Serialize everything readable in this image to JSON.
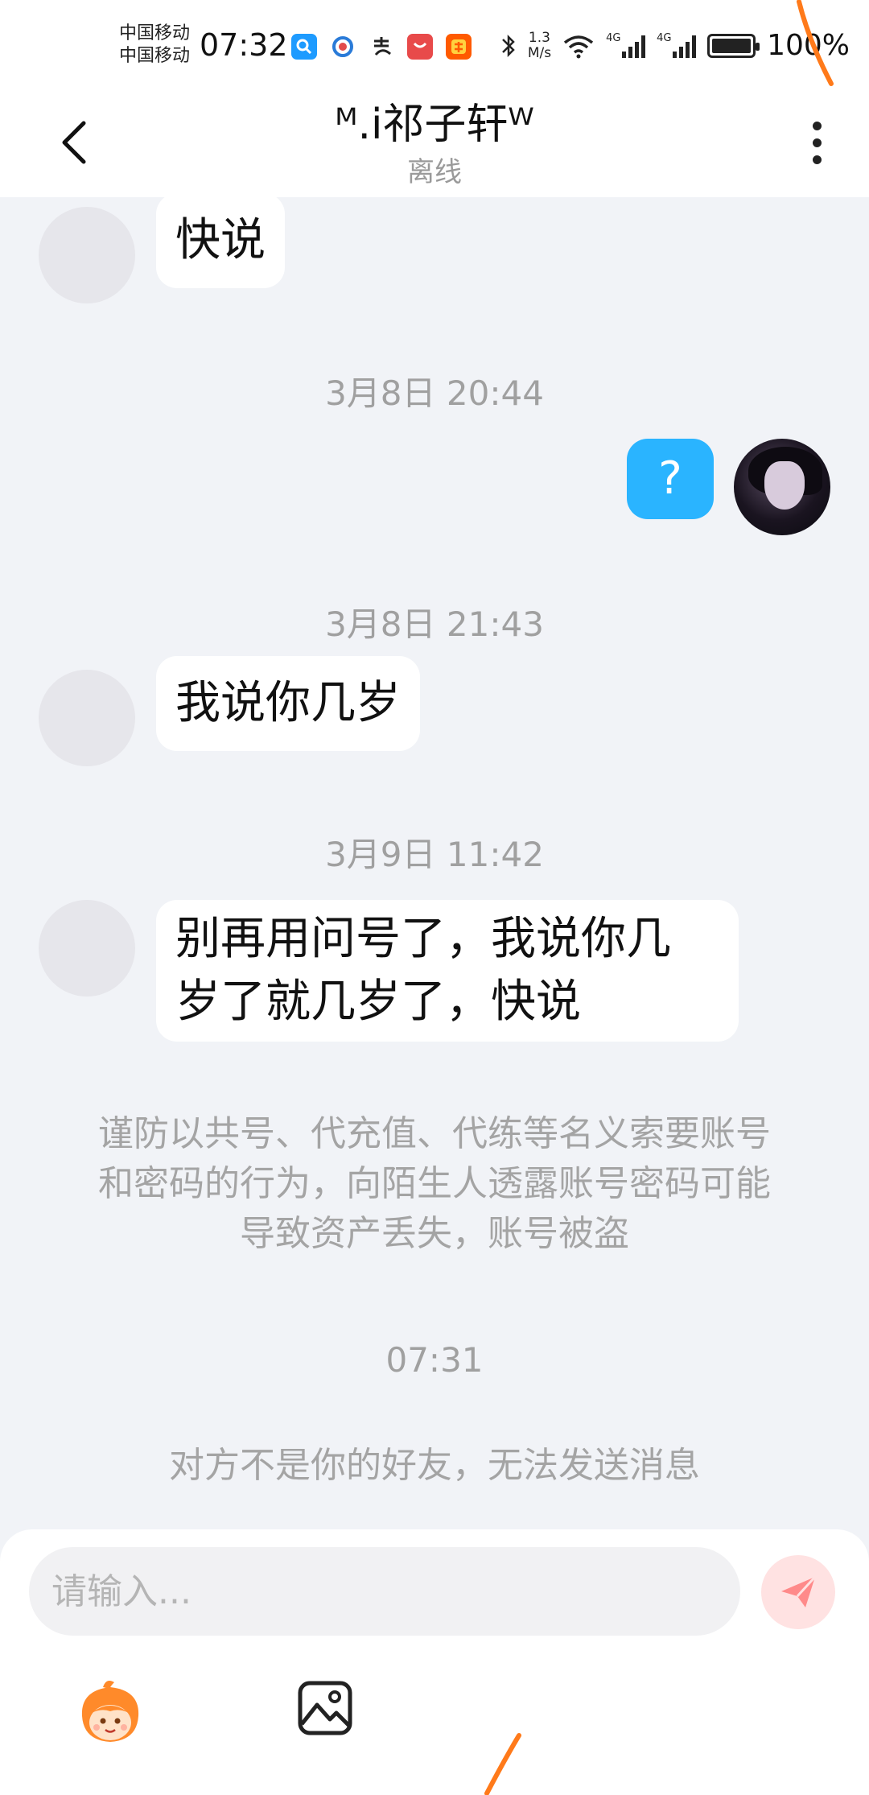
{
  "status_bar": {
    "carrier_1": "中国移动",
    "carrier_2": "中国移动",
    "time": "07:32",
    "net_speed_value": "1.3",
    "net_speed_unit": "M/s",
    "network_1": "4G",
    "network_2": "4G",
    "battery": "100%",
    "apps": [
      "search-app-icon",
      "photo-app-icon",
      "alipay-icon",
      "huawei-store-icon",
      "taobao-icon"
    ]
  },
  "header": {
    "title": "ᴹ.i祁子轩ᵂ",
    "subtitle": "离线"
  },
  "messages": [
    {
      "type": "received",
      "text": "快说"
    },
    {
      "type": "timestamp",
      "text": "3月8日 20:44"
    },
    {
      "type": "sent",
      "text": "?"
    },
    {
      "type": "timestamp",
      "text": "3月8日 21:43"
    },
    {
      "type": "received",
      "text": "我说你几岁"
    },
    {
      "type": "timestamp",
      "text": "3月9日 11:42"
    },
    {
      "type": "received",
      "line_1": "别再用问号了，我说你几",
      "line_2": "岁了就几岁了，快说"
    },
    {
      "type": "notice",
      "line_1": "谨防以共号、代充值、代练等名义索要账号",
      "line_2": "和密码的行为，向陌生人透露账号密码可能",
      "line_3": "导致资产丢失，账号被盗"
    },
    {
      "type": "timestamp",
      "text": "07:31"
    },
    {
      "type": "notice",
      "text": "对方不是你的好友，无法发送消息"
    }
  ],
  "composer": {
    "placeholder": "请输入...",
    "send_icon": "paper-plane-icon",
    "emoji_icon": "emoji-mascot-icon",
    "image_icon": "image-icon"
  },
  "colors": {
    "accent_sent_bubble": "#2ab4ff",
    "chat_background": "#f1f3f7",
    "send_button_bg": "#ffe2e2",
    "send_icon": "#ff6b6b"
  }
}
